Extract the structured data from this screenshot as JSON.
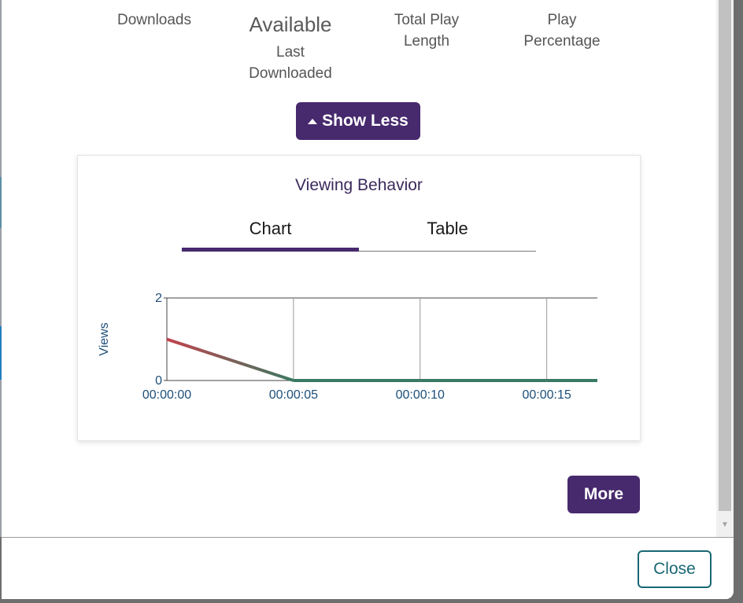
{
  "stats": {
    "downloads": {
      "label": "Downloads"
    },
    "last_downloaded": {
      "value": "Available",
      "label_line1": "Last",
      "label_line2": "Downloaded"
    },
    "total_play_length": {
      "label_line1": "Total Play",
      "label_line2": "Length"
    },
    "play_percentage": {
      "label_line1": "Play",
      "label_line2": "Percentage"
    }
  },
  "show_less_label": "Show Less",
  "card": {
    "title": "Viewing Behavior",
    "tabs": [
      "Chart",
      "Table"
    ],
    "active_tab": "Chart"
  },
  "chart_data": {
    "type": "line",
    "ylabel": "Views",
    "ylim": [
      0,
      2
    ],
    "y_ticks": [
      "0",
      "2"
    ],
    "x": [
      "00:00:00",
      "00:00:05",
      "00:00:10",
      "00:00:15",
      "00:00:17"
    ],
    "x_tick_labels": [
      "00:00:00",
      "00:00:05",
      "00:00:10",
      "00:00:15"
    ],
    "values": [
      1,
      0,
      0,
      0,
      0
    ],
    "grid": true,
    "colors": {
      "start": "#c2434d",
      "end": "#3a7a63",
      "axis_text": "#1d4f7a"
    }
  },
  "more_label": "More",
  "close_label": "Close"
}
